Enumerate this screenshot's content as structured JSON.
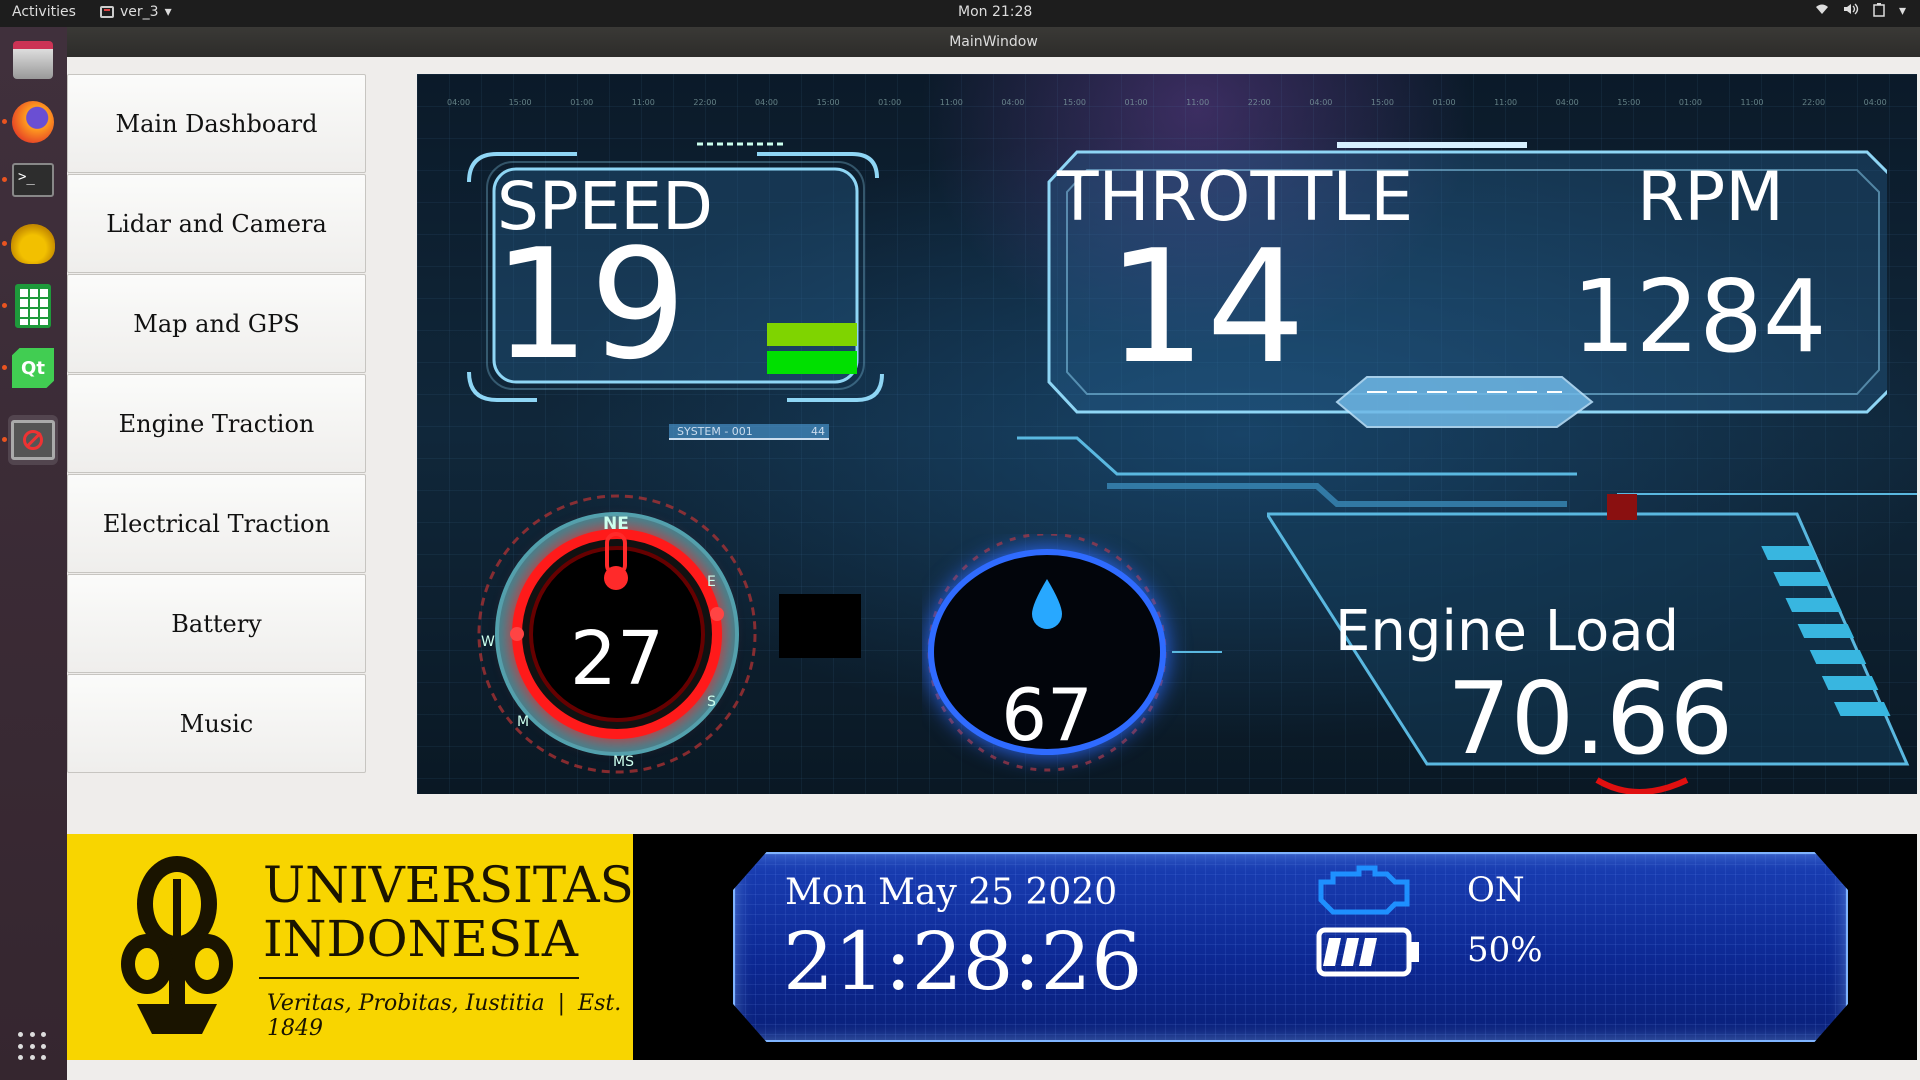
{
  "topbar": {
    "activities": "Activities",
    "app_name": "ver_3",
    "clock": "Mon 21:28"
  },
  "window": {
    "title": "MainWindow"
  },
  "nav": [
    {
      "label": "Main Dashboard"
    },
    {
      "label": "Lidar and Camera"
    },
    {
      "label": "Map and GPS"
    },
    {
      "label": "Engine Traction"
    },
    {
      "label": "Electrical Traction"
    },
    {
      "label": "Battery"
    },
    {
      "label": "Music"
    }
  ],
  "dashboard": {
    "speed": {
      "label": "SPEED",
      "value": "19"
    },
    "system_label": "SYSTEM - 001",
    "system_value": "44",
    "throttle": {
      "label": "THROTTLE",
      "value": "14"
    },
    "rpm": {
      "label": "RPM",
      "value": "1284"
    },
    "temperature": {
      "value": "27"
    },
    "humidity": {
      "value": "67"
    },
    "engine_load": {
      "label": "Engine Load",
      "value": "70.66"
    },
    "compass": {
      "ne": "NE",
      "e": "E",
      "s": "S",
      "ms": "MS",
      "m": "M",
      "w": "W"
    },
    "timeline": [
      "04:00",
      "15:00",
      "01:00",
      "11:00",
      "22:00",
      "04:00",
      "15:00",
      "01:00",
      "11:00",
      "04:00",
      "15:00",
      "01:00",
      "11:00",
      "22:00",
      "04:00",
      "15:00",
      "01:00",
      "11:00",
      "04:00",
      "15:00",
      "01:00",
      "11:00",
      "22:00",
      "04:00"
    ]
  },
  "university": {
    "line1": "UNIVERSITAS",
    "line2": "INDONESIA",
    "motto": "Veritas, Probitas, Iustitia",
    "est": "Est. 1849"
  },
  "status": {
    "date": "Mon May 25 2020",
    "time": "21:28:26",
    "engine_state": "ON",
    "battery": "50%"
  },
  "colors": {
    "accent_blue": "#1a3fb5",
    "ui_yellow": "#f8d500",
    "speed_green": "#00e000",
    "temp_red": "#e01010"
  }
}
